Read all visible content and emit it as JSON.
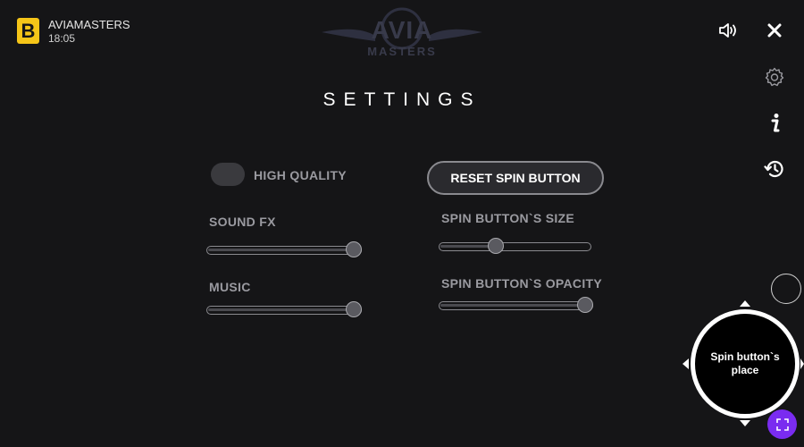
{
  "brand": {
    "badge_letter": "B",
    "name": "AVIAMASTERS",
    "time": "18:05",
    "accent": "#f5c518"
  },
  "logo": {
    "line1": "AVIA",
    "line2": "MASTERS"
  },
  "settings": {
    "title": "SETTINGS",
    "high_quality_label": "HIGH QUALITY",
    "high_quality_on": false,
    "reset_button": "RESET SPIN BUTTON",
    "sound_fx": {
      "label": "SOUND FX",
      "value": 1.0
    },
    "music": {
      "label": "MUSIC",
      "value": 1.0
    },
    "spin_size": {
      "label": "SPIN BUTTON`S SIZE",
      "value": 0.36
    },
    "spin_opacity": {
      "label": "SPIN BUTTON`S OPACITY",
      "value": 1.0
    }
  },
  "right_controls": {
    "icons": [
      "volume-icon",
      "close-icon",
      "gear-icon",
      "info-icon",
      "history-icon",
      "fullscreen-icon"
    ]
  },
  "spin_place": {
    "label": "Spin button`s place"
  },
  "colors": {
    "purple": "#7a2cf0"
  }
}
